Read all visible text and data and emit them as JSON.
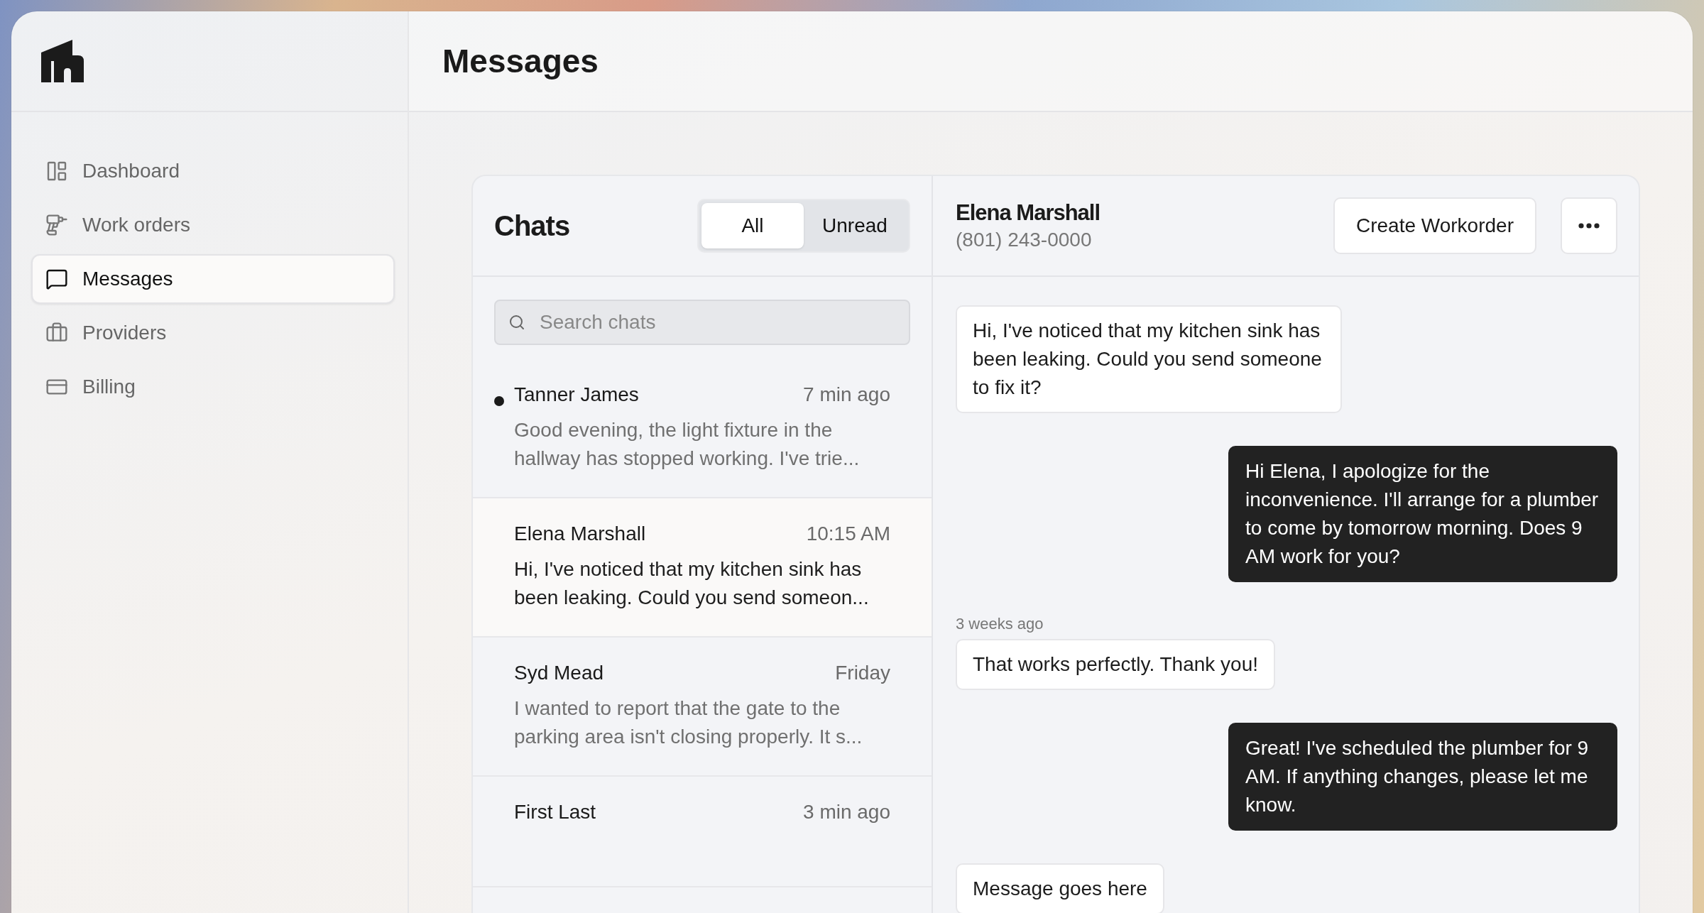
{
  "header": {
    "title": "Messages"
  },
  "sidebar": {
    "items": [
      {
        "label": "Dashboard",
        "selected": false
      },
      {
        "label": "Work orders",
        "selected": false
      },
      {
        "label": "Messages",
        "selected": true
      },
      {
        "label": "Providers",
        "selected": false
      },
      {
        "label": "Billing",
        "selected": false
      }
    ]
  },
  "chats": {
    "title": "Chats",
    "filters": [
      {
        "label": "All",
        "selected": true
      },
      {
        "label": "Unread",
        "selected": false
      }
    ],
    "search": {
      "placeholder": "Search chats"
    },
    "items": [
      {
        "name": "Tanner James",
        "time": "7 min ago",
        "preview": "Good evening, the light fixture in the hallway has stopped working. I've trie...",
        "unread": true,
        "selected": false
      },
      {
        "name": "Elena Marshall",
        "time": "10:15 AM",
        "preview": "Hi, I've noticed that my kitchen sink has been leaking. Could you send someon...",
        "unread": false,
        "selected": true
      },
      {
        "name": "Syd Mead",
        "time": "Friday",
        "preview": "I wanted to report that the gate to the parking area isn't closing properly. It s...",
        "unread": false,
        "selected": false
      },
      {
        "name": "First Last",
        "time": "3 min ago",
        "unread": false,
        "selected": false
      }
    ]
  },
  "conversation": {
    "contact": {
      "name": "Elena Marshall",
      "phone": "(801) 243-0000"
    },
    "action": {
      "label": "Create Workorder"
    },
    "messages": [
      {
        "kind": "incoming",
        "text": "Hi, I've noticed that my kitchen sink has been leaking. Could you send someone to fix it?"
      },
      {
        "kind": "outgoing",
        "text": "Hi Elena, I apologize for the inconvenience. I'll arrange for a plumber to come by tomorrow morning. Does 9 AM work for you?"
      },
      {
        "kind": "incoming",
        "timestamp": "3 weeks ago",
        "text": "That works perfectly. Thank you!"
      },
      {
        "kind": "outgoing",
        "text": "Great! I've scheduled the plumber for 9 AM. If anything changes, please let me know."
      },
      {
        "kind": "incoming",
        "text": "Message goes here"
      }
    ]
  }
}
